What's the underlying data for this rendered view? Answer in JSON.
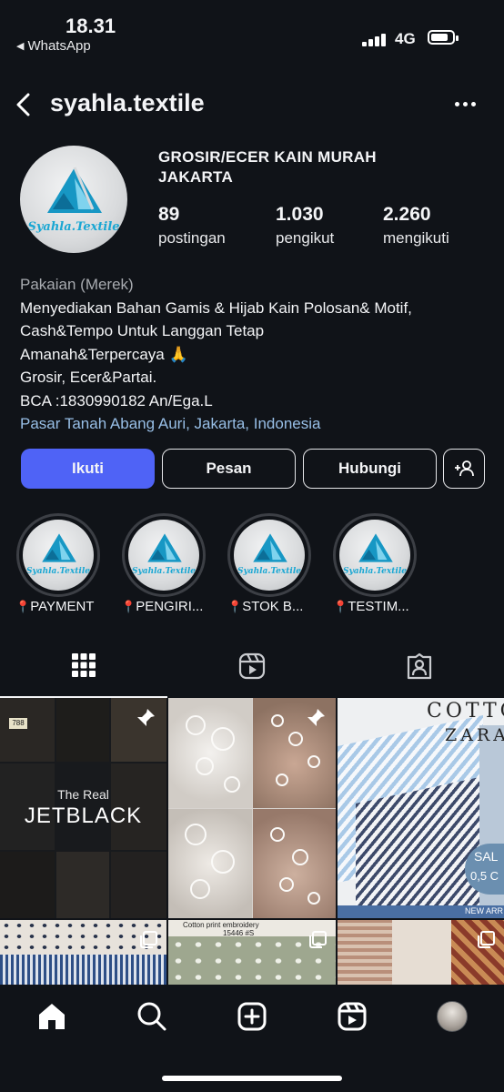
{
  "status_bar": {
    "time": "18.31",
    "back_app": "WhatsApp",
    "network": "4G"
  },
  "header": {
    "username": "syahla.textile"
  },
  "profile": {
    "avatar_logo_text": "Syahla.Textile",
    "display_name": "GROSIR/ECER KAIN MURAH JAKARTA",
    "stats": [
      {
        "value": "89",
        "label": "postingan"
      },
      {
        "value": "1.030",
        "label": "pengikut"
      },
      {
        "value": "2.260",
        "label": "mengikuti"
      }
    ],
    "category": "Pakaian (Merek)",
    "bio_lines": [
      "Menyediakan Bahan Gamis & Hijab Kain Polosan& Motif,",
      "Cash&Tempo Untuk Langgan Tetap",
      "Amanah&Terpercaya 🙏",
      "Grosir, Ecer&Partai.",
      "BCA :1830990182 An/Ega.L"
    ],
    "location": "Pasar Tanah Abang Auri, Jakarta, Indonesia"
  },
  "actions": {
    "follow": "Ikuti",
    "message": "Pesan",
    "contact": "Hubungi"
  },
  "highlights": [
    {
      "label": "PAYMENT",
      "logo_text": "Syahla.Textile"
    },
    {
      "label": "PENGIRI...",
      "logo_text": "Syahla.Textile"
    },
    {
      "label": "STOK B...",
      "logo_text": "Syahla.Textile"
    },
    {
      "label": "TESTIM...",
      "logo_text": "Syahla.Textile"
    }
  ],
  "tabs": [
    {
      "name": "grid-icon",
      "active": true
    },
    {
      "name": "reels-icon",
      "active": false
    },
    {
      "name": "tagged-icon",
      "active": false
    }
  ],
  "posts": {
    "post1": {
      "line1": "The Real",
      "line2": "JETBLACK",
      "label_code": "788"
    },
    "post3": {
      "title1": "COTTO",
      "title2": "ZARA",
      "sale1": "SAL",
      "sale2": "0,5 C",
      "footer": "NEW ARR"
    },
    "post5": {
      "line1": "Cotton print embroidery",
      "line2": "15446 #S"
    }
  },
  "bottom_nav": [
    "home-icon",
    "search-icon",
    "create-icon",
    "reels-icon",
    "profile-avatar"
  ]
}
